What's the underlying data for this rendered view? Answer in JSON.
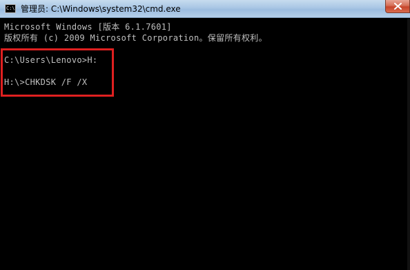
{
  "window": {
    "title": "管理员: C:\\Windows\\system32\\cmd.exe",
    "icon_label": "C:\\"
  },
  "console": {
    "lines": [
      "Microsoft Windows [版本 6.1.7601]",
      "版权所有 (c) 2009 Microsoft Corporation。保留所有权利。",
      "",
      "C:\\Users\\Lenovo>H:",
      "",
      "H:\\>CHKDSK /F /X"
    ]
  },
  "colors": {
    "console_background": "#000000",
    "console_text": "#c0c0c0",
    "highlight_border": "#e02020",
    "titlebar": "#a9c6e4",
    "close_button": "#c7442a"
  },
  "icons": {
    "app": "cmd-icon",
    "close": "close-icon"
  }
}
